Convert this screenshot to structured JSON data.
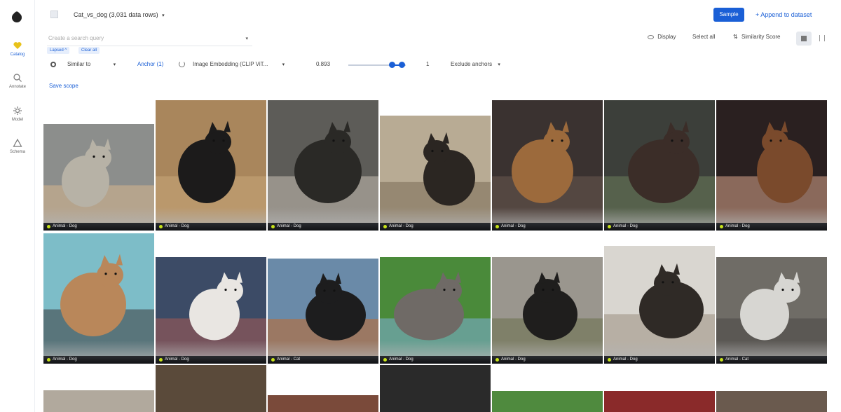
{
  "sidebar": {
    "items": [
      {
        "label": "Catalog",
        "icon": "heart-icon",
        "active": true
      },
      {
        "label": "Annotate",
        "icon": "annotate-icon",
        "active": false
      },
      {
        "label": "Model",
        "icon": "gear-icon",
        "active": false
      },
      {
        "label": "Schema",
        "icon": "triangle-icon",
        "active": false
      }
    ]
  },
  "header": {
    "dataset_title": "Cat_vs_dog (3,031 data rows)",
    "dropdown_glyph": "▾",
    "sample_label": "Sample",
    "append_label": "+  Append to dataset"
  },
  "search": {
    "placeholder": "Create a search query",
    "chips": [
      "Lapsed ^",
      "Clear all"
    ]
  },
  "tools": {
    "display": "Display",
    "select_all": "Select all",
    "similarity": "Similarity Score"
  },
  "filter": {
    "mode": "Similar to",
    "anchor": "Anchor (1)",
    "embedding": "Image Embedding (CLIP ViT...",
    "threshold_min": "0.893",
    "threshold_max": "1",
    "slider_min_fraction": 0.76,
    "slider_max_fraction": 0.93,
    "exclude": "Exclude anchors"
  },
  "save_scope": "Save scope",
  "colors": {
    "accent": "#1a5fd6",
    "label_dot": "#c7e21a"
  },
  "grid": [
    {
      "label": "Animal - Dog",
      "colors": [
        "#8c8e8c",
        "#b7b2a6",
        "#d7b68e"
      ]
    },
    {
      "label": "Animal - Dog",
      "colors": [
        "#a9865c",
        "#1c1b1b",
        "#c9a77a"
      ]
    },
    {
      "label": "Animal - Dog",
      "colors": [
        "#5d5c58",
        "#2a2926",
        "#c7c0b4"
      ]
    },
    {
      "label": "Animal - Dog",
      "colors": [
        "#b8ab94",
        "#2b2622",
        "#7a6b55"
      ]
    },
    {
      "label": "Animal - Dog",
      "colors": [
        "#3a3230",
        "#9c6a3c",
        "#6a5a50"
      ]
    },
    {
      "label": "Animal - Dog",
      "colors": [
        "#3c3f3a",
        "#3b2d28",
        "#6b7d5b"
      ]
    },
    {
      "label": "Animal - Dog",
      "colors": [
        "#2a2020",
        "#7a4a2c",
        "#d9a68c"
      ]
    },
    {
      "label": "Animal - Dog",
      "colors": [
        "#7dbdc8",
        "#b9875a",
        "#3c3a3c"
      ]
    },
    {
      "label": "Animal - Dog",
      "colors": [
        "#3c4b66",
        "#e9e6e2",
        "#a65b54"
      ]
    },
    {
      "label": "Animal - Cat",
      "colors": [
        "#6a8aa8",
        "#1d1d1e",
        "#c26a2a"
      ]
    },
    {
      "label": "Animal - Dog",
      "colors": [
        "#4a8a3a",
        "#6f6a66",
        "#7fb0d8"
      ]
    },
    {
      "label": "Animal - Dog",
      "colors": [
        "#9a968e",
        "#1f1e1d",
        "#6a6f4a"
      ]
    },
    {
      "label": "Animal - Dog",
      "colors": [
        "#d9d6d0",
        "#2f2a26",
        "#9a8f80"
      ]
    },
    {
      "label": "Animal - Cat",
      "colors": [
        "#6f6c66",
        "#d7d6d2",
        "#4a4946"
      ]
    }
  ]
}
